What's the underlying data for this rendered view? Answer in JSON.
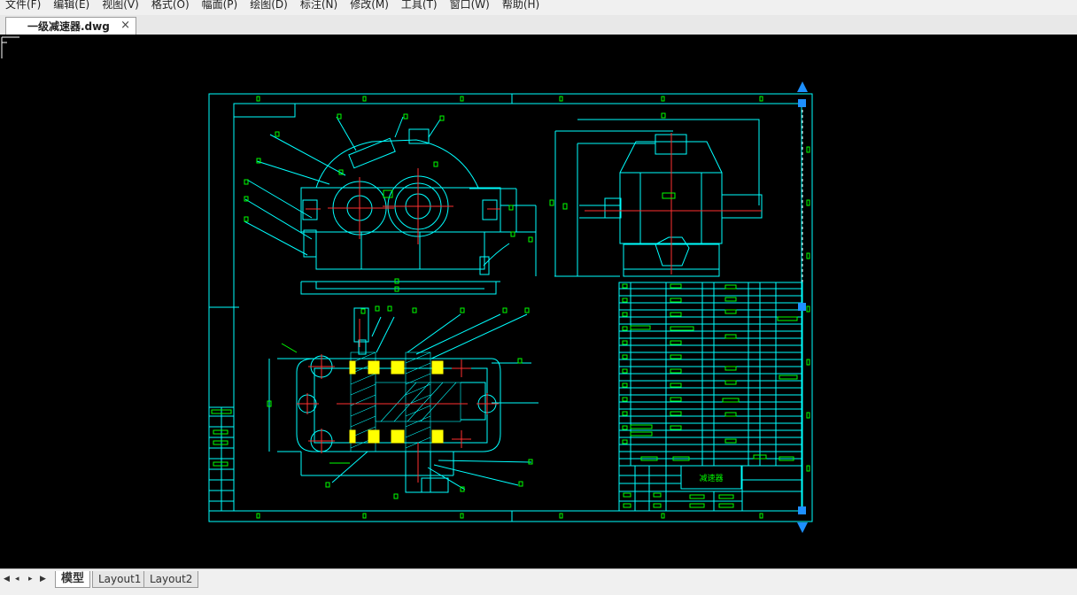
{
  "menubar": {
    "items": [
      "文件(F)",
      "编辑(E)",
      "视图(V)",
      "格式(O)",
      "幅面(P)",
      "绘图(D)",
      "标注(N)",
      "修改(M)",
      "工具(T)",
      "窗口(W)",
      "帮助(H)"
    ]
  },
  "document_tab": {
    "title": "一级减速器.dwg",
    "close": "×"
  },
  "drawing": {
    "title_block_name": "减速器"
  },
  "layout_tabs": [
    "模型",
    "Layout1",
    "Layout2"
  ],
  "colors": {
    "line": "#00ffff",
    "text": "#00ff00",
    "center": "#ff3030",
    "bearing": "#ffff00",
    "grip": "#1e90ff",
    "background": "#000000"
  }
}
